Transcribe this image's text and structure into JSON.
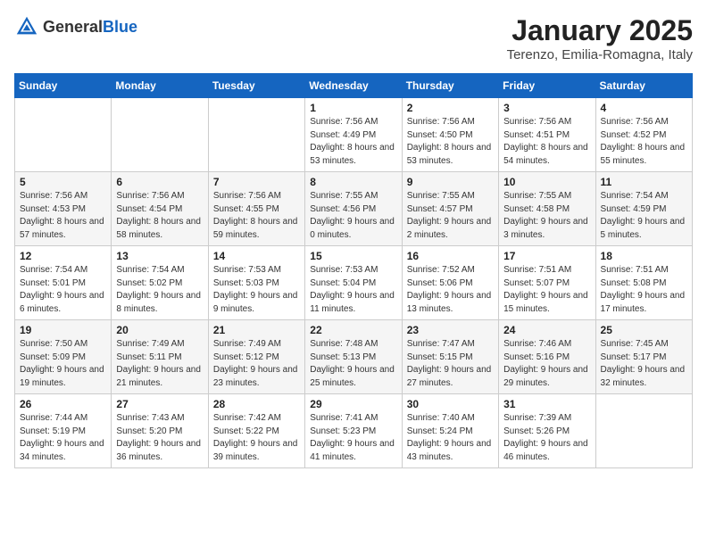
{
  "header": {
    "logo_general": "General",
    "logo_blue": "Blue",
    "title": "January 2025",
    "subtitle": "Terenzo, Emilia-Romagna, Italy"
  },
  "days_of_week": [
    "Sunday",
    "Monday",
    "Tuesday",
    "Wednesday",
    "Thursday",
    "Friday",
    "Saturday"
  ],
  "weeks": [
    [
      {
        "day": "",
        "sunrise": "",
        "sunset": "",
        "daylight": ""
      },
      {
        "day": "",
        "sunrise": "",
        "sunset": "",
        "daylight": ""
      },
      {
        "day": "",
        "sunrise": "",
        "sunset": "",
        "daylight": ""
      },
      {
        "day": "1",
        "sunrise": "Sunrise: 7:56 AM",
        "sunset": "Sunset: 4:49 PM",
        "daylight": "Daylight: 8 hours and 53 minutes."
      },
      {
        "day": "2",
        "sunrise": "Sunrise: 7:56 AM",
        "sunset": "Sunset: 4:50 PM",
        "daylight": "Daylight: 8 hours and 53 minutes."
      },
      {
        "day": "3",
        "sunrise": "Sunrise: 7:56 AM",
        "sunset": "Sunset: 4:51 PM",
        "daylight": "Daylight: 8 hours and 54 minutes."
      },
      {
        "day": "4",
        "sunrise": "Sunrise: 7:56 AM",
        "sunset": "Sunset: 4:52 PM",
        "daylight": "Daylight: 8 hours and 55 minutes."
      }
    ],
    [
      {
        "day": "5",
        "sunrise": "Sunrise: 7:56 AM",
        "sunset": "Sunset: 4:53 PM",
        "daylight": "Daylight: 8 hours and 57 minutes."
      },
      {
        "day": "6",
        "sunrise": "Sunrise: 7:56 AM",
        "sunset": "Sunset: 4:54 PM",
        "daylight": "Daylight: 8 hours and 58 minutes."
      },
      {
        "day": "7",
        "sunrise": "Sunrise: 7:56 AM",
        "sunset": "Sunset: 4:55 PM",
        "daylight": "Daylight: 8 hours and 59 minutes."
      },
      {
        "day": "8",
        "sunrise": "Sunrise: 7:55 AM",
        "sunset": "Sunset: 4:56 PM",
        "daylight": "Daylight: 9 hours and 0 minutes."
      },
      {
        "day": "9",
        "sunrise": "Sunrise: 7:55 AM",
        "sunset": "Sunset: 4:57 PM",
        "daylight": "Daylight: 9 hours and 2 minutes."
      },
      {
        "day": "10",
        "sunrise": "Sunrise: 7:55 AM",
        "sunset": "Sunset: 4:58 PM",
        "daylight": "Daylight: 9 hours and 3 minutes."
      },
      {
        "day": "11",
        "sunrise": "Sunrise: 7:54 AM",
        "sunset": "Sunset: 4:59 PM",
        "daylight": "Daylight: 9 hours and 5 minutes."
      }
    ],
    [
      {
        "day": "12",
        "sunrise": "Sunrise: 7:54 AM",
        "sunset": "Sunset: 5:01 PM",
        "daylight": "Daylight: 9 hours and 6 minutes."
      },
      {
        "day": "13",
        "sunrise": "Sunrise: 7:54 AM",
        "sunset": "Sunset: 5:02 PM",
        "daylight": "Daylight: 9 hours and 8 minutes."
      },
      {
        "day": "14",
        "sunrise": "Sunrise: 7:53 AM",
        "sunset": "Sunset: 5:03 PM",
        "daylight": "Daylight: 9 hours and 9 minutes."
      },
      {
        "day": "15",
        "sunrise": "Sunrise: 7:53 AM",
        "sunset": "Sunset: 5:04 PM",
        "daylight": "Daylight: 9 hours and 11 minutes."
      },
      {
        "day": "16",
        "sunrise": "Sunrise: 7:52 AM",
        "sunset": "Sunset: 5:06 PM",
        "daylight": "Daylight: 9 hours and 13 minutes."
      },
      {
        "day": "17",
        "sunrise": "Sunrise: 7:51 AM",
        "sunset": "Sunset: 5:07 PM",
        "daylight": "Daylight: 9 hours and 15 minutes."
      },
      {
        "day": "18",
        "sunrise": "Sunrise: 7:51 AM",
        "sunset": "Sunset: 5:08 PM",
        "daylight": "Daylight: 9 hours and 17 minutes."
      }
    ],
    [
      {
        "day": "19",
        "sunrise": "Sunrise: 7:50 AM",
        "sunset": "Sunset: 5:09 PM",
        "daylight": "Daylight: 9 hours and 19 minutes."
      },
      {
        "day": "20",
        "sunrise": "Sunrise: 7:49 AM",
        "sunset": "Sunset: 5:11 PM",
        "daylight": "Daylight: 9 hours and 21 minutes."
      },
      {
        "day": "21",
        "sunrise": "Sunrise: 7:49 AM",
        "sunset": "Sunset: 5:12 PM",
        "daylight": "Daylight: 9 hours and 23 minutes."
      },
      {
        "day": "22",
        "sunrise": "Sunrise: 7:48 AM",
        "sunset": "Sunset: 5:13 PM",
        "daylight": "Daylight: 9 hours and 25 minutes."
      },
      {
        "day": "23",
        "sunrise": "Sunrise: 7:47 AM",
        "sunset": "Sunset: 5:15 PM",
        "daylight": "Daylight: 9 hours and 27 minutes."
      },
      {
        "day": "24",
        "sunrise": "Sunrise: 7:46 AM",
        "sunset": "Sunset: 5:16 PM",
        "daylight": "Daylight: 9 hours and 29 minutes."
      },
      {
        "day": "25",
        "sunrise": "Sunrise: 7:45 AM",
        "sunset": "Sunset: 5:17 PM",
        "daylight": "Daylight: 9 hours and 32 minutes."
      }
    ],
    [
      {
        "day": "26",
        "sunrise": "Sunrise: 7:44 AM",
        "sunset": "Sunset: 5:19 PM",
        "daylight": "Daylight: 9 hours and 34 minutes."
      },
      {
        "day": "27",
        "sunrise": "Sunrise: 7:43 AM",
        "sunset": "Sunset: 5:20 PM",
        "daylight": "Daylight: 9 hours and 36 minutes."
      },
      {
        "day": "28",
        "sunrise": "Sunrise: 7:42 AM",
        "sunset": "Sunset: 5:22 PM",
        "daylight": "Daylight: 9 hours and 39 minutes."
      },
      {
        "day": "29",
        "sunrise": "Sunrise: 7:41 AM",
        "sunset": "Sunset: 5:23 PM",
        "daylight": "Daylight: 9 hours and 41 minutes."
      },
      {
        "day": "30",
        "sunrise": "Sunrise: 7:40 AM",
        "sunset": "Sunset: 5:24 PM",
        "daylight": "Daylight: 9 hours and 43 minutes."
      },
      {
        "day": "31",
        "sunrise": "Sunrise: 7:39 AM",
        "sunset": "Sunset: 5:26 PM",
        "daylight": "Daylight: 9 hours and 46 minutes."
      },
      {
        "day": "",
        "sunrise": "",
        "sunset": "",
        "daylight": ""
      }
    ]
  ]
}
